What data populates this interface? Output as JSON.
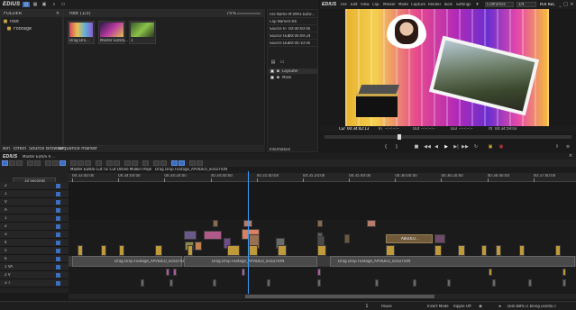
{
  "app": {
    "logo": "EDIUS",
    "menu": [
      "File",
      "Edit",
      "View",
      "Clip",
      "Marker",
      "Mode",
      "Capture",
      "Render",
      "Tools",
      "Settings"
    ],
    "frame_rate_select": "Fullframes",
    "scale_select": "1/4",
    "mode_badge": "PLR REC"
  },
  "folder_panel": {
    "title": "FOLDER",
    "root": "root",
    "child": "Footage",
    "tabs": [
      "Bin",
      "Effect",
      "Source Browser",
      "Sequence marker"
    ]
  },
  "bin": {
    "path": "root (1/3)",
    "zoom": "75%",
    "items": [
      {
        "label": "Drag Dro...",
        "thumb": "gradient"
      },
      {
        "label": "Master EDIUS...",
        "thumb": "purple"
      },
      {
        "label": "1",
        "thumb": "green"
      }
    ]
  },
  "info_panel": {
    "rows": [
      {
        "key": "File Name",
        "value": "M:\\MP3 EDIU..."
      },
      {
        "key": "Clip Name",
        "value": "0:06"
      },
      {
        "key": "Source In",
        "value": "00:00:00:00"
      },
      {
        "key": "Source Out",
        "value": "00:00:09:24"
      },
      {
        "key": "Source Dur",
        "value": "00:00:10:00"
      }
    ],
    "effects": [
      "Layouter",
      "Mask"
    ],
    "tab": "Information"
  },
  "player": {
    "cur_label": "Cur",
    "cur_time": "00:34:42:13",
    "in_label": "In",
    "in_time": "--:--:--:--",
    "out_label": "Out",
    "out_time": "--:--:--:--",
    "dur_label": "Dur",
    "dur_time": "--:--:--:--",
    "ttl_label": "Ttl",
    "ttl_time": "00:34:59:03",
    "playhead_position": 0.3
  },
  "timeline": {
    "logo": "EDIUS",
    "sequence_name": "Master EDIUS 9 ...",
    "tab_name": "Master EDIUS Cut Tic Cut Online Mulkin Project...",
    "tab2_name": "Drag Drop Footage_APVIDEO_SOLUTION",
    "scale": "10 Seconds",
    "ruler": [
      "00:33:40:00",
      "00:34:00:00",
      "00:34:20:00",
      "00:34:40:00",
      "00:35:00:00",
      "00:35:20:00",
      "00:35:40:00",
      "00:36:00:00",
      "00:36:20:00",
      "00:36:40:00",
      "00:37:00:00"
    ],
    "track_labels": [
      "2",
      "1",
      "V",
      "A",
      "1",
      "2",
      "3",
      "4",
      "5",
      "6",
      "1 VA",
      "2 V",
      "3 T"
    ],
    "long_clips": [
      "Drag Drop Footage_APVIDEO_SOLUTION",
      "Drag Drop Footage_APVIDEO_SOLUTION",
      "ABSOLU..."
    ]
  },
  "status": {
    "pause": "Pause",
    "insert_mode": "Insert Mode",
    "ripple": "Ripple Off",
    "disk": "Disk:88% is being used(E:)"
  },
  "colors": {
    "accent": "#3b6fc4",
    "bg": "#1a1a1a",
    "panel": "#202020",
    "track_blue": "#2e4978",
    "track_gray": "#4e4e4e"
  }
}
